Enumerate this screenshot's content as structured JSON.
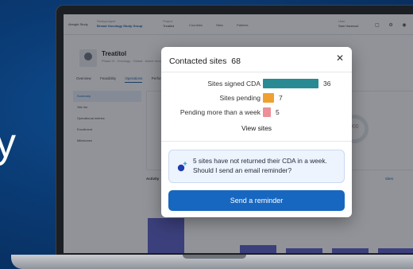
{
  "hero": {
    "text": "y"
  },
  "app": {
    "header": {
      "logo": "Airsight Study",
      "crumb_label": "Study/project",
      "crumb": "Breast Oncology Study Group",
      "project_label": "Project",
      "project": "Treatitol",
      "nav": [
        "Countries",
        "Sites",
        "Patients"
      ],
      "user_label": "User",
      "user": "Sam Harwood"
    },
    "study_title": "Treatitol",
    "study_subtitle": "Phase III · Oncology · Global · Active recruitment",
    "tabs": [
      "Overview",
      "Feasibility",
      "Operations",
      "Performance"
    ],
    "active_tab_index": 2,
    "sidebar": [
      "Summary",
      "Site list",
      "Operational metrics",
      "Enrollment",
      "Milestones"
    ],
    "gauge_value": "000",
    "activity_title": "Activity",
    "sites_title": "Sites"
  },
  "modal": {
    "title": "Contacted sites",
    "count": "68",
    "close_icon": "close-icon",
    "metrics": [
      {
        "label": "Sites signed CDA",
        "value": 36,
        "color": "#2a8a94"
      },
      {
        "label": "Sites pending",
        "value": 7,
        "color": "#f0a030"
      },
      {
        "label": "Pending more than a week",
        "value": 5,
        "color": "#ec8f96"
      }
    ],
    "view_sites": "View sites",
    "ai_icon": "sparkle-assistant-icon",
    "ai_message": "5 sites have not returned their CDA in a week. Should I send an email reminder?",
    "send_button": "Send a reminder"
  },
  "colors": {
    "primary": "#1767c0",
    "background": "#0a3a73",
    "ai_box": "#eef4fd"
  }
}
